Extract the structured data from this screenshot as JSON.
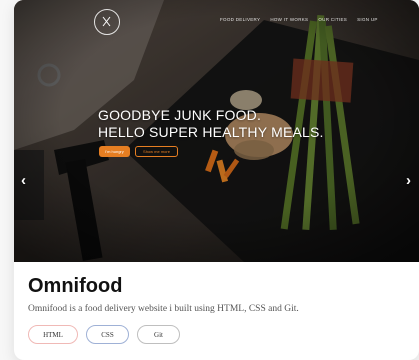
{
  "hero": {
    "nav": [
      "FOOD DELIVERY",
      "HOW IT WORKS",
      "OUR CITIES",
      "SIGN UP"
    ],
    "headline": [
      "GOODBYE JUNK FOOD.",
      "HELLO SUPER HEALTHY MEALS."
    ],
    "cta_primary": "I'm hungry",
    "cta_secondary": "Show me more",
    "arrow_left": "‹",
    "arrow_right": "›"
  },
  "project": {
    "title": "Omnifood",
    "description": "Omnifood is a food delivery website i built using HTML, CSS and Git.",
    "tags": [
      "HTML",
      "CSS",
      "Git"
    ]
  },
  "colors": {
    "accent": "#e67e22",
    "html_tag_border": "#f0b9b6",
    "css_tag_border": "#9fb1d6",
    "git_tag_border": "#bfbfbf"
  },
  "icons": {
    "logo": "fork-knife-icon",
    "prev": "chevron-left-icon",
    "next": "chevron-right-icon"
  }
}
